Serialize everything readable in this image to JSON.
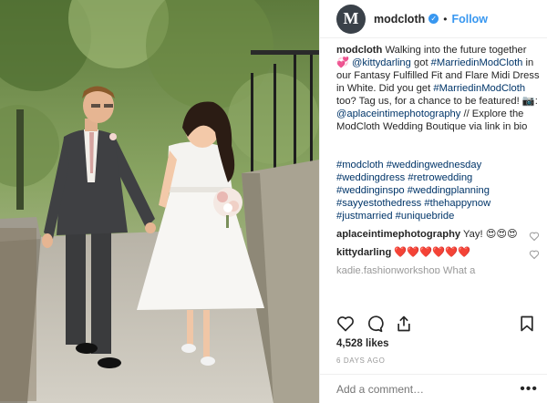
{
  "header": {
    "avatar_letter": "M",
    "username": "modcloth",
    "verified_mark": "✓",
    "separator": "•",
    "follow_label": "Follow"
  },
  "caption": {
    "username": "modcloth",
    "text_1": " Walking into the future together ",
    "emoji_hearts": "💞",
    "mention_1": "@kittydarling",
    "text_2": " got ",
    "tag_1": "#MarriedinModCloth",
    "text_3": " in our Fantasy Fulfilled Fit and Flare Midi Dress in White. Did you get ",
    "tag_2": "#MarriedinModCloth",
    "text_4": " too? Tag us, for a chance to be featured! ",
    "emoji_camera": "📷",
    "text_5": ": ",
    "mention_2": "@aplaceintimephotography",
    "text_6": " // Explore the ModCloth Wedding Boutique via link in bio",
    "hashtags": "#modcloth #weddingwednesday #weddingdress #retrowedding #weddinginspo #weddingplanning #sayyestothedress #thehappynow #justmarried #uniquebride"
  },
  "comments": [
    {
      "username": "aplaceintimephotography",
      "text": " Yay! 😍😍😍"
    },
    {
      "username": "kittydarling",
      "text": " ❤️❤️❤️❤️❤️❤️"
    }
  ],
  "partial_comment": "kadie.fashionworkshop What a",
  "likes": "4,528 likes",
  "time_ago": "6 DAYS AGO",
  "add_comment_placeholder": "Add a comment…",
  "more_label": "•••",
  "icons": {
    "like": "heart-icon",
    "comment": "comment-icon",
    "share": "share-icon",
    "save": "bookmark-icon"
  },
  "colors": {
    "link": "#003569",
    "follow": "#3897f0",
    "muted": "#999999"
  }
}
